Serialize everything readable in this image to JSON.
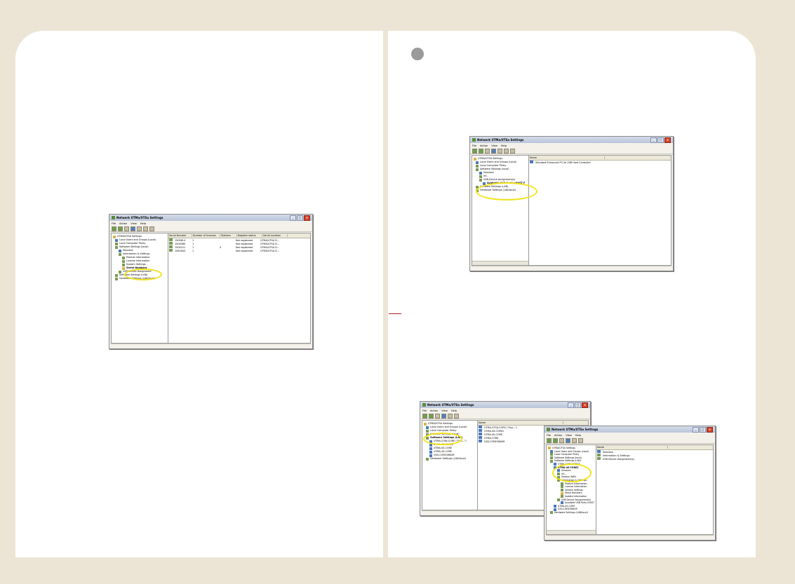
{
  "window_title": "Network UTMa/UTSa Settings",
  "menu": [
    "File",
    "Action",
    "View",
    "Help"
  ],
  "win1": {
    "tree": [
      "UTMA/UTSA Settings",
      "Local Users and Groups (Local)",
      "Local Computer Policy",
      "Software Settings (local)",
      "Sessions",
      "Information & Settings",
      "Product Information",
      "License Information",
      "System Settings",
      "Serial Numbers",
      "USB Device Assignment",
      "Software Settings (LAN)",
      "Hardware Settings (LAN/local)"
    ],
    "columns": [
      "Serial Number",
      "Number of licenses",
      "Stations",
      "Register status",
      "Serial Location"
    ],
    "rows": [
      [
        "1500814",
        "1",
        "",
        "Not registered",
        "UTMA/UTSA D..."
      ],
      [
        "1504080",
        "1",
        "",
        "Not registered",
        "UTMA/UTSA D..."
      ],
      [
        "1504151",
        "1",
        "4",
        "Not registered",
        "UTMA/UTSA D..."
      ],
      [
        "1561643",
        "1",
        "",
        "Not registered",
        "UTMA/UTSA D..."
      ]
    ]
  },
  "win2": {
    "tree": [
      "UTMA/UTSA Settings",
      "Local Users and Groups (Local)",
      "Local Computer Policy",
      "Software Settings (local)",
      "Sessions",
      "Inf...",
      "USB-Device Assignment(s)",
      "Available USB Ports (HOST F",
      "Software Settings (LAN)",
      "Hardware Settings (LAN/local)"
    ],
    "columns": [
      "Name"
    ],
    "rows": [
      [
        "Standard Enhanced PCI to USB Host Controller"
      ]
    ]
  },
  "win3": {
    "tree": [
      "UTMA/UTSA Settings",
      "Local Users and Groups (Local)",
      "Local Computer Policy",
      "Software Settings (local)",
      "Software Settings (LAN)",
      "UTMA-CONI-CORE (\"Sou...\")",
      "UTMA-4S-CORE2",
      "UTMA-0S-CORE",
      "UTMA-4S-CORE",
      "GSS-COREO86UR",
      "Hardware Settings (LAN/local)"
    ],
    "columns": [
      "Name"
    ],
    "rows": [
      [
        "UTMA-UTSA-CORE (\"Sou...\")"
      ],
      [
        "UTMA-4S-CORE2"
      ],
      [
        "UTMA-4S-CORE"
      ],
      [
        "UTMA-CORE"
      ],
      [
        "GSS-COREO86UR"
      ]
    ]
  },
  "win4": {
    "tree": [
      "UTMA/UTSA Settings",
      "Local Users and Groups (Local)",
      "Local Computer Policy",
      "Software Settings (local)",
      "Software Settings (LAN)",
      "UTMA-CORE-CORE3",
      "UTMA-4S-CORE2",
      "Sessions",
      "Inf...",
      "Session WAN",
      "Information & Settings",
      "Product Information",
      "License Information",
      "System Settings",
      "Serial Numbers",
      "Update Information",
      "USB Device Assignment(s)",
      "Available USB Ports (HOST",
      "UTMA-4S-CORE",
      "GSS-COREO86UR",
      "Hardware Settings (LAN/local)"
    ],
    "columns": [
      "Name"
    ],
    "rows": [
      [
        "Sessions"
      ],
      [
        "Information & Settings"
      ],
      [
        "USB Device Assignment(s)"
      ]
    ]
  }
}
